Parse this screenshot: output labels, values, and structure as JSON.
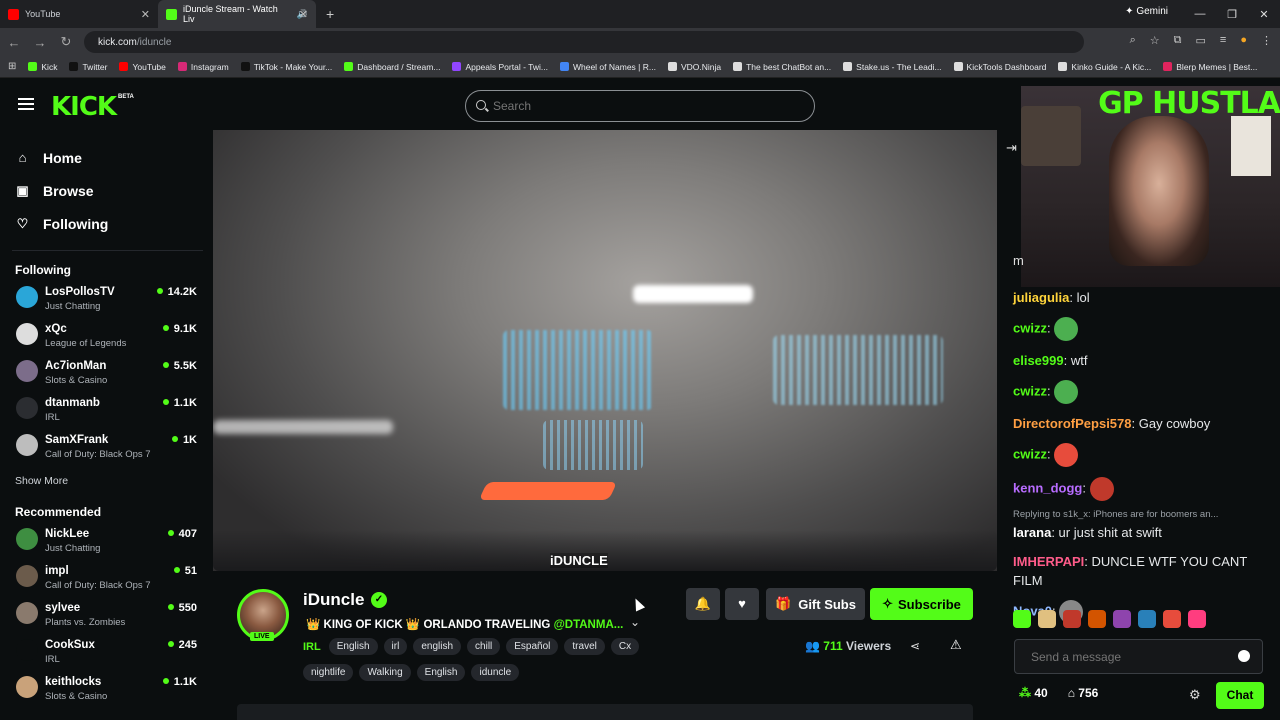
{
  "browser": {
    "tabs": [
      {
        "label": "YouTube",
        "color": "#ff0000"
      },
      {
        "label": "iDuncle Stream - Watch Liv",
        "color": "#53fc18"
      }
    ],
    "gemini_label": "Gemini",
    "url_host": "kick.com",
    "url_path": "/iduncle",
    "bookmarks": [
      {
        "label": "Kick",
        "color": "#53fc18"
      },
      {
        "label": "Twitter",
        "color": "#111111"
      },
      {
        "label": "YouTube",
        "color": "#ff0000"
      },
      {
        "label": "Instagram",
        "color": "#d62976"
      },
      {
        "label": "TikTok - Make Your...",
        "color": "#111111"
      },
      {
        "label": "Dashboard / Stream...",
        "color": "#53fc18"
      },
      {
        "label": "Appeals Portal - Twi...",
        "color": "#9146ff"
      },
      {
        "label": "Wheel of Names | R...",
        "color": "#4285f4"
      },
      {
        "label": "VDO.Ninja",
        "color": "#dddddd"
      },
      {
        "label": "The best ChatBot an...",
        "color": "#dddddd"
      },
      {
        "label": "Stake.us - The Leadi...",
        "color": "#dddddd"
      },
      {
        "label": "KickTools Dashboard",
        "color": "#dddddd"
      },
      {
        "label": "Kinko Guide - A Kic...",
        "color": "#dddddd"
      },
      {
        "label": "Blerp Memes | Best...",
        "color": "#e0245e"
      }
    ]
  },
  "header": {
    "logo": "KICK",
    "beta": "BETA",
    "search_placeholder": "Search"
  },
  "sidebar": {
    "nav": [
      {
        "label": "Home",
        "icon": "⌂"
      },
      {
        "label": "Browse",
        "icon": "▣"
      },
      {
        "label": "Following",
        "icon": "♡"
      }
    ],
    "following_heading": "Following",
    "following": [
      {
        "name": "LosPollosTV",
        "category": "Just Chatting",
        "viewers": "14.2K",
        "color": "#2aa6d8"
      },
      {
        "name": "xQc",
        "category": "League of Legends",
        "viewers": "9.1K",
        "color": "#dddddd"
      },
      {
        "name": "Ac7ionMan",
        "category": "Slots & Casino",
        "viewers": "5.5K",
        "color": "#7c6d8a"
      },
      {
        "name": "dtanmanb",
        "category": "IRL",
        "viewers": "1.1K",
        "color": "#2b2d31"
      },
      {
        "name": "SamXFrank",
        "category": "Call of Duty: Black Ops 7",
        "viewers": "1K",
        "color": "#bdbdbd"
      }
    ],
    "show_more": "Show More",
    "recommended_heading": "Recommended",
    "recommended": [
      {
        "name": "NickLee",
        "category": "Just Chatting",
        "viewers": "407",
        "color": "#3e8e41"
      },
      {
        "name": "impl",
        "category": "Call of Duty: Black Ops 7",
        "viewers": "51",
        "color": "#6b5b4b"
      },
      {
        "name": "sylvee",
        "category": "Plants vs. Zombies",
        "viewers": "550",
        "color": "#8a7a6d"
      },
      {
        "name": "CookSux",
        "category": "IRL",
        "viewers": "245",
        "color": "#0b0e0f"
      },
      {
        "name": "keithlocks",
        "category": "Slots & Casino",
        "viewers": "1.1K",
        "color": "#c9a27a"
      }
    ]
  },
  "video": {
    "watermark": "iDUNCLE"
  },
  "stream": {
    "name": "iDuncle",
    "live_badge": "LIVE",
    "title_prefix": "👑 KING OF KICK 👑 ORLANDO TRAVELING ",
    "title_mention": "@DTANMA...",
    "category": "IRL",
    "tags": [
      "English",
      "irl",
      "english",
      "chill",
      "Español",
      "travel",
      "Cx",
      "nightlife",
      "Walking",
      "English",
      "iduncle"
    ],
    "gift_label": "Gift Subs",
    "subscribe_label": "Subscribe",
    "viewer_count": "711",
    "viewers_label": "Viewers"
  },
  "chat": {
    "cam_title": "GP HUSTLA",
    "partial_line": "m",
    "messages": [
      {
        "user": "juliagulia",
        "color": "#ffd43b",
        "text": "lol",
        "emote": ""
      },
      {
        "user": "cwizz",
        "color": "#53fc18",
        "text": "",
        "emote": "#4caf50"
      },
      {
        "user": "elise999",
        "color": "#53fc18",
        "text": "wtf",
        "emote": ""
      },
      {
        "user": "cwizz",
        "color": "#53fc18",
        "text": "",
        "emote": "#4caf50"
      },
      {
        "user": "DirectorofPepsi578",
        "color": "#ff9f43",
        "text": "Gay cowboy",
        "emote": ""
      },
      {
        "user": "cwizz",
        "color": "#53fc18",
        "text": "",
        "emote": "#e74c3c"
      },
      {
        "user": "kenn_dogg",
        "color": "#b86cff",
        "text": "",
        "emote": "#c0392b"
      },
      {
        "user": "larana",
        "color": "#ffffff",
        "text": "ur just shit at swift",
        "emote": "",
        "reply": "Replying to s1k_x: iPhones are for boomers an..."
      },
      {
        "user": "IMHERPAPI",
        "color": "#ff5c8a",
        "text": "DUNCLE WTF YOU CANT FILM",
        "emote": ""
      },
      {
        "user": "Nova0",
        "color": "#8fb8ff",
        "text": "",
        "emote": "#888888"
      }
    ],
    "send_placeholder": "Send a message",
    "points": "40",
    "gifts": "756",
    "chat_button": "Chat"
  }
}
